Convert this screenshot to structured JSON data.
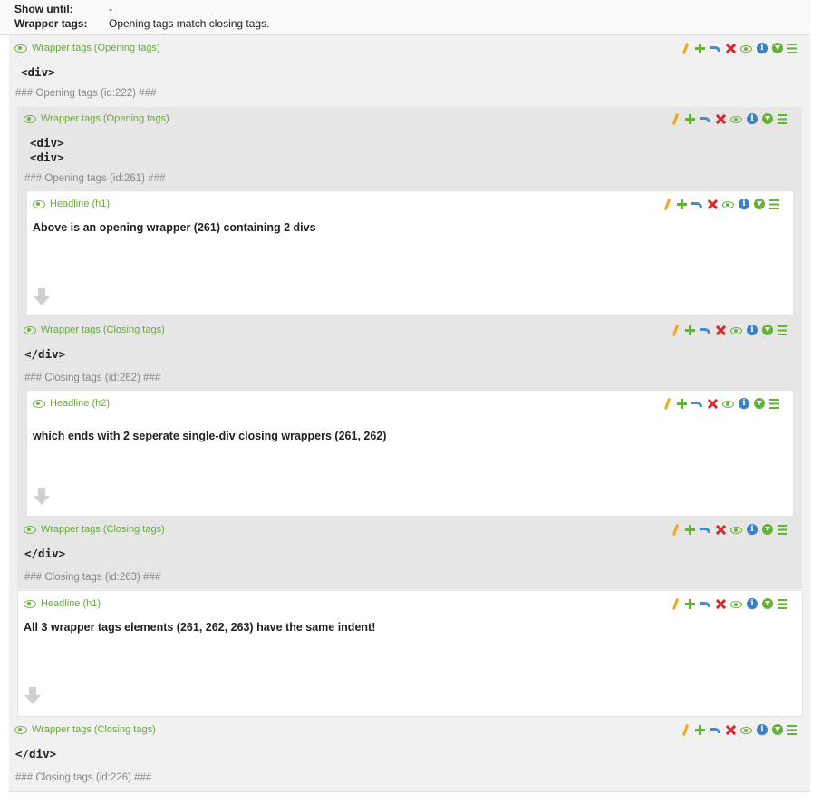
{
  "info": {
    "show_until_label": "Show until:",
    "show_until_value": "-",
    "wrapper_tags_label": "Wrapper tags:",
    "wrapper_tags_value": "Opening tags match closing tags."
  },
  "elements": {
    "w222": {
      "label": "Wrapper tags (Opening tags)",
      "tags": [
        "<div>"
      ],
      "footer": "### Opening tags (id:222) ###"
    },
    "w261": {
      "label": "Wrapper tags (Opening tags)",
      "tags": [
        "<div>",
        "<div>"
      ],
      "footer": "### Opening tags (id:261) ###"
    },
    "h1a": {
      "label": "Headline (h1)",
      "text": "Above is an opening wrapper (261) containing 2 divs"
    },
    "w262": {
      "label": "Wrapper tags (Closing tags)",
      "tags": [
        "</div>"
      ],
      "footer": "### Closing tags (id:262) ###"
    },
    "h2": {
      "label": "Headline (h2)",
      "text": "which ends with 2 seperate single-div closing wrappers (261, 262)"
    },
    "w263": {
      "label": "Wrapper tags (Closing tags)",
      "tags": [
        "</div>"
      ],
      "footer": "### Closing tags (id:263) ###"
    },
    "h1b": {
      "label": "Headline (h1)",
      "text": "All 3 wrapper tags elements (261, 262, 263) have the same indent!"
    },
    "w226": {
      "label": "Wrapper tags (Closing tags)",
      "tags": [
        "</div>"
      ],
      "footer": "### Closing tags (id:226) ###"
    }
  },
  "toolbar_icons": [
    "edit-icon",
    "add-icon",
    "move-icon",
    "delete-icon",
    "visibility-icon",
    "info-icon",
    "more-icon",
    "drag-icon"
  ],
  "colors": {
    "label_green": "#6aa73a",
    "delete_red": "#d9292c",
    "info_blue": "#3b7fc4",
    "edit_orange": "#f3a51b"
  }
}
